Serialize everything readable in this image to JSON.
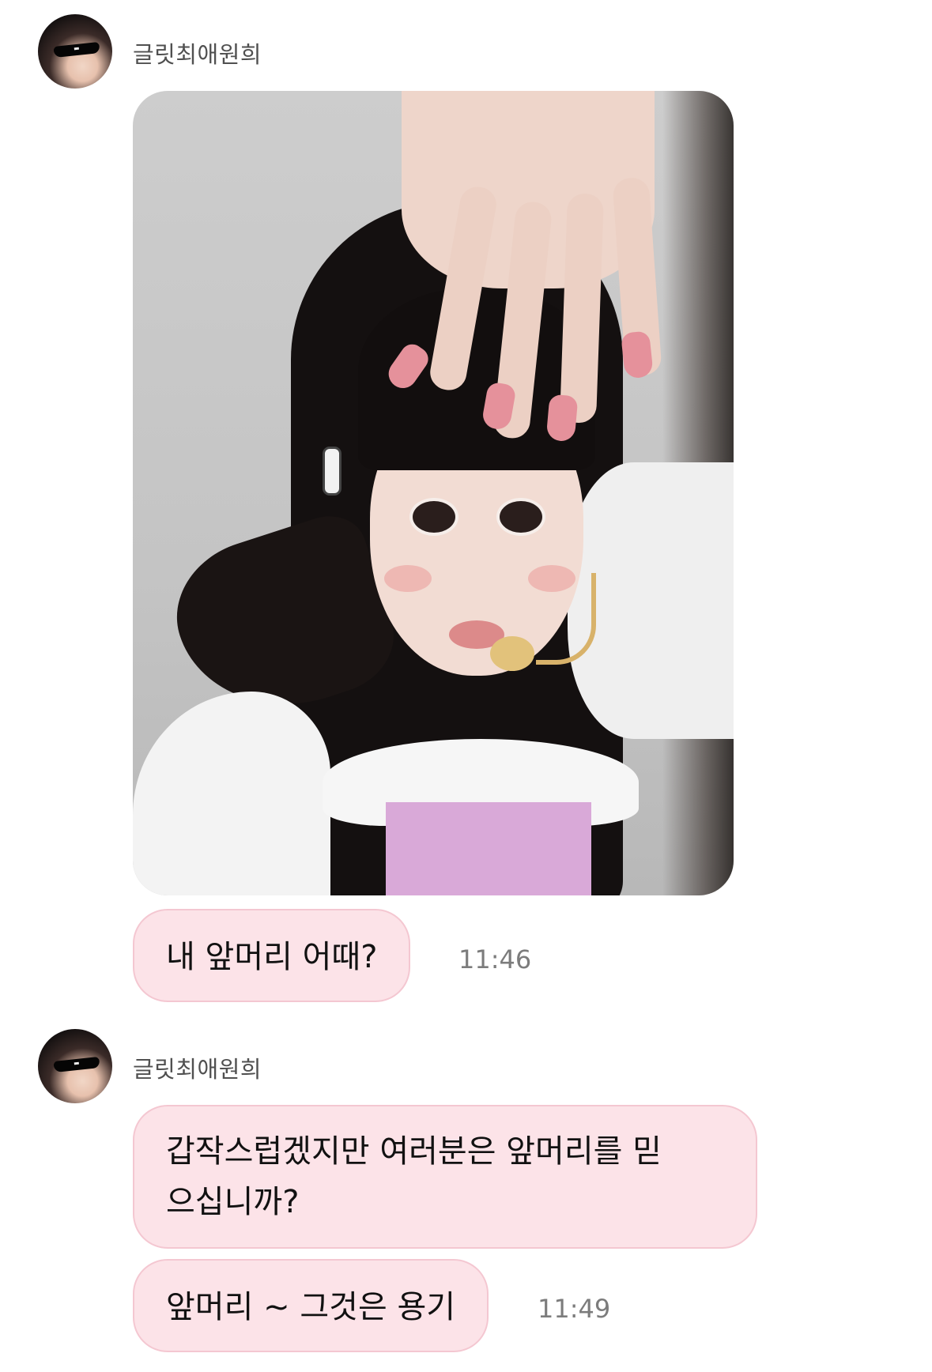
{
  "messages": [
    {
      "sender": "글릿최애원희",
      "avatar_icon": "profile-avatar",
      "photo_icon": "selfie-photo",
      "bubbles": [
        {
          "text": "내 앞머리 어때?"
        }
      ],
      "time": "11:46"
    },
    {
      "sender": "글릿최애원희",
      "avatar_icon": "profile-avatar",
      "bubbles": [
        {
          "line1": "갑작스럽겠지만 여러분은 앞머리를 믿",
          "line2": "으십니까?"
        },
        {
          "text": "앞머리 ~ 그것은 용기"
        }
      ],
      "time": "11:49"
    }
  ],
  "colors": {
    "bubble_bg": "#fce3e8",
    "bubble_border": "#f4c7d1",
    "sender_text": "#505050",
    "time_text": "#7c7c7c"
  }
}
